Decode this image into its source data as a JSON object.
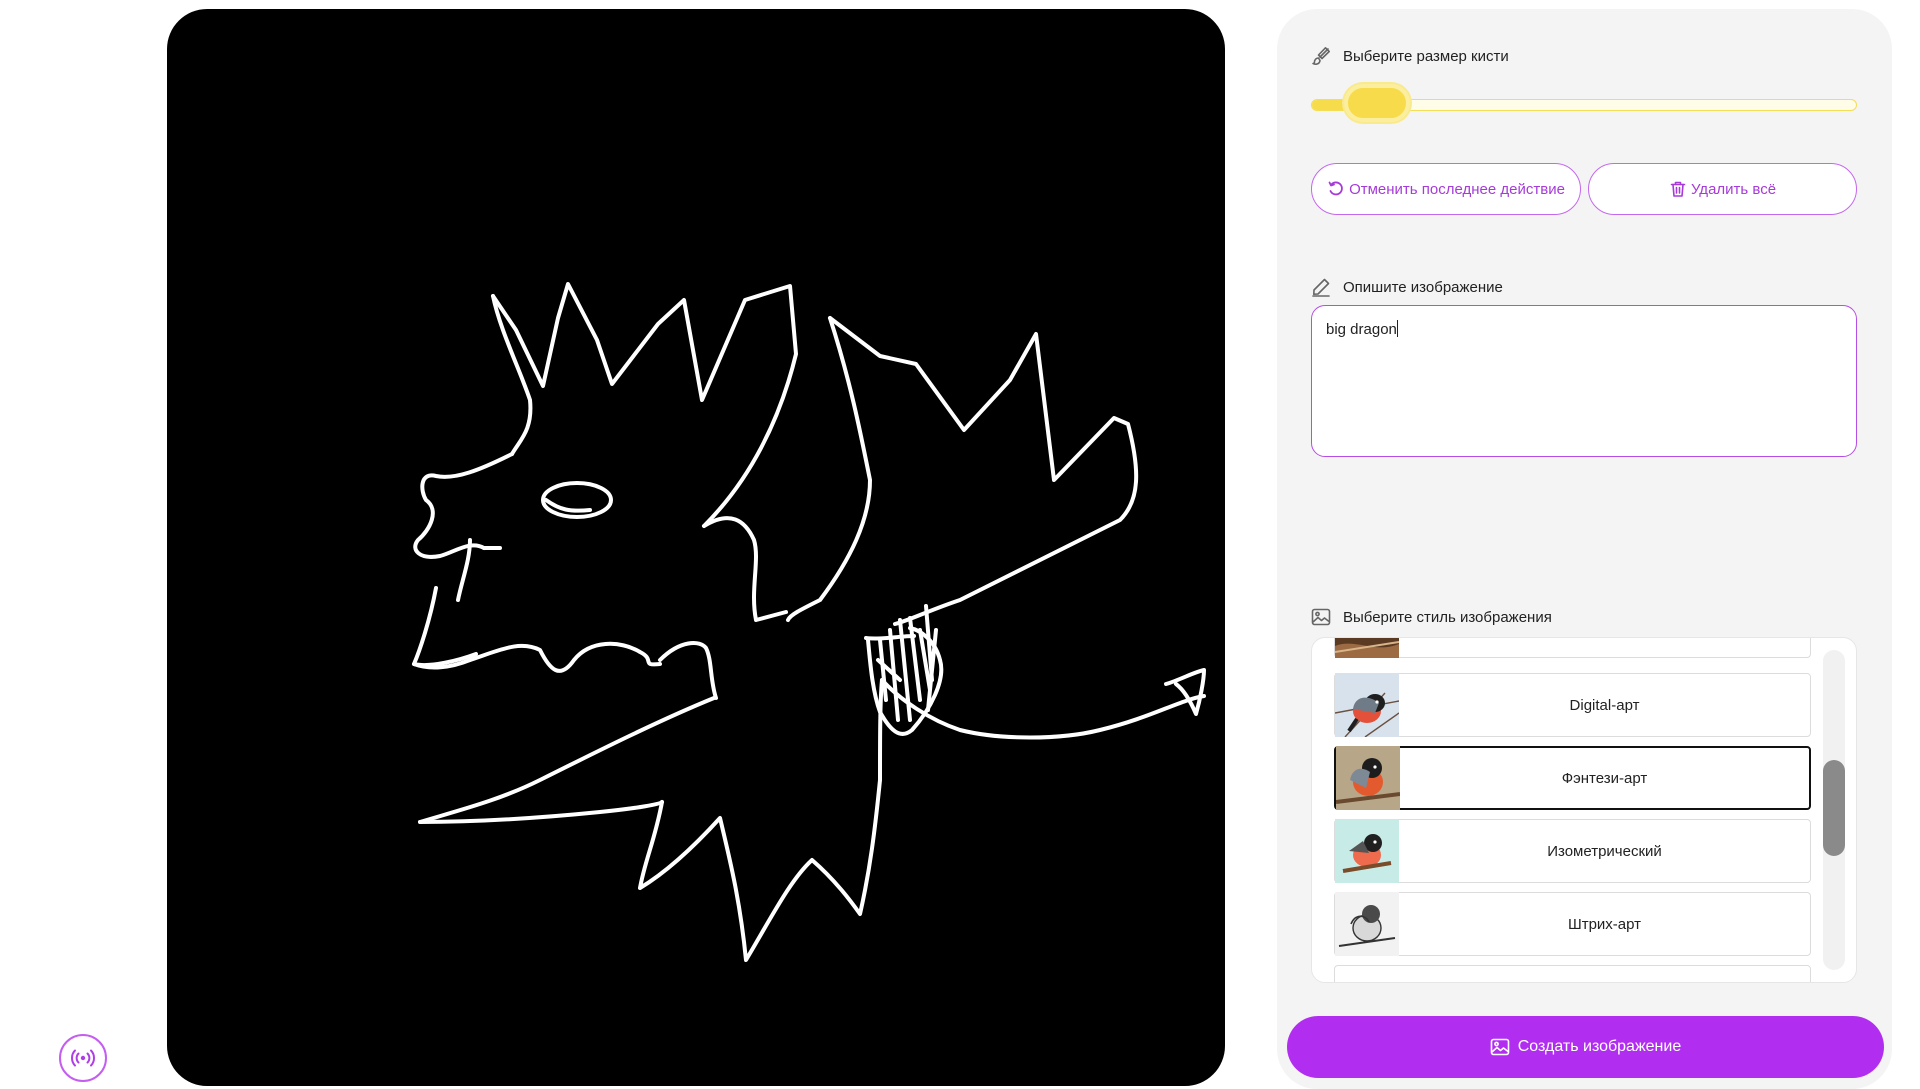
{
  "brush": {
    "label": "Выберите размер кисти",
    "icon": "brush-icon",
    "value_fraction": 0.12,
    "accent": "#f6dc4b"
  },
  "actions": {
    "undo_label": "Отменить последнее действие",
    "clear_label": "Удалить всё"
  },
  "prompt": {
    "label": "Опишите изображение",
    "value": "big dragon"
  },
  "styles": {
    "label": "Выберите стиль изображения",
    "items": [
      {
        "label": "",
        "thumb": "partial-top"
      },
      {
        "label": "Digital-арт",
        "thumb": "bird-digital"
      },
      {
        "label": "Фэнтези-арт",
        "thumb": "bird-fantasy",
        "selected": true
      },
      {
        "label": "Изометрический",
        "thumb": "bird-isometric"
      },
      {
        "label": "Штрих-арт",
        "thumb": "bird-sketch"
      }
    ]
  },
  "create": {
    "label": "Создать изображение"
  },
  "colors": {
    "accent": "#b12ef0",
    "canvas_bg": "#000000",
    "stroke": "#ffffff"
  }
}
